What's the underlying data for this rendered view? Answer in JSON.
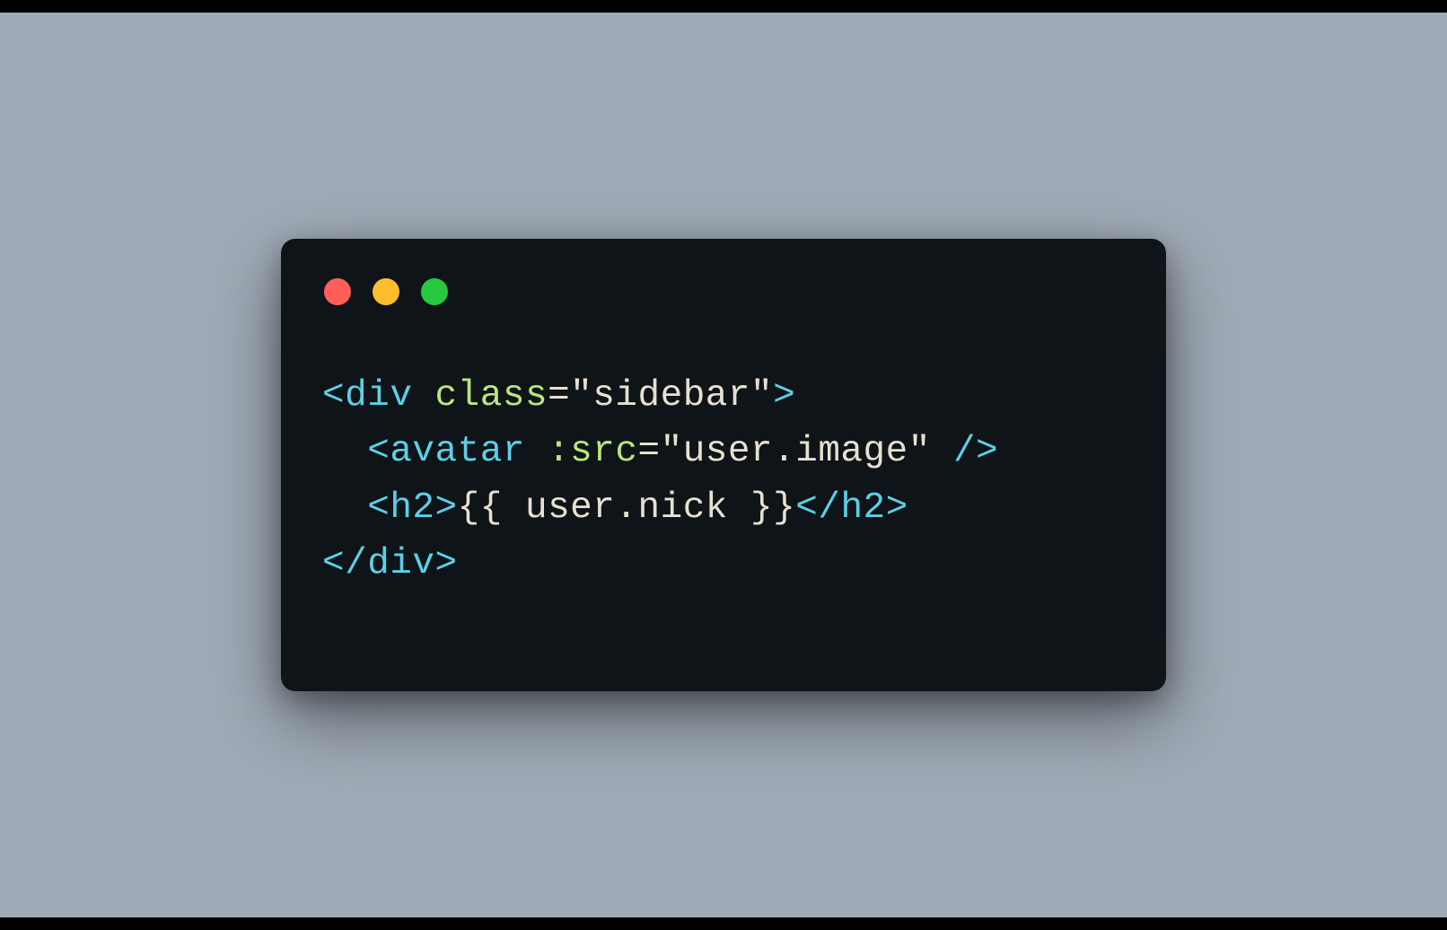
{
  "colors": {
    "background": "#a0abb7",
    "window_bg": "#0f1419",
    "red": "#ff5f56",
    "yellow": "#ffbd2e",
    "green": "#27c93f",
    "punctuation": "#5ccfe6",
    "tag": "#5ccfe6",
    "attribute": "#bae67e",
    "string": "#e6e1cf",
    "text": "#e6e1cf"
  },
  "code": {
    "l1": {
      "p1": "<",
      "tag": "div",
      "sp": " ",
      "attr": "class",
      "eq": "=",
      "str": "\"sidebar\"",
      "p2": ">"
    },
    "l2": {
      "indent": "  ",
      "p1": "<",
      "tag": "avatar",
      "sp": " ",
      "attr": ":src",
      "eq": "=",
      "str": "\"user.image\"",
      "sp2": " ",
      "p2": "/>"
    },
    "l3": {
      "indent": "  ",
      "p1": "<",
      "tag1": "h2",
      "p2": ">",
      "text": "{{ user.nick }}",
      "p3": "</",
      "tag2": "h2",
      "p4": ">"
    },
    "l4": {
      "p1": "</",
      "tag": "div",
      "p2": ">"
    }
  }
}
